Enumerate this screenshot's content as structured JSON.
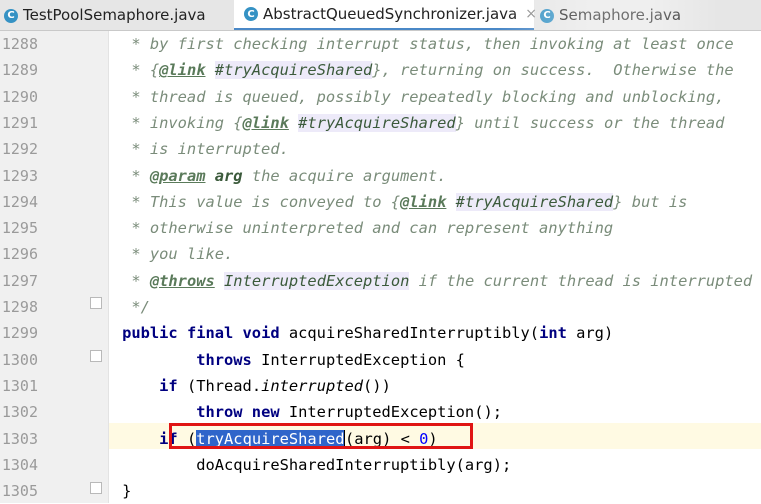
{
  "tabs": [
    {
      "label": "TestPoolSemaphore.java",
      "icon": "c-class-icon",
      "active": false
    },
    {
      "label": "AbstractQueuedSynchronizer.java",
      "icon": "c-class-icon",
      "active": true,
      "close": "×"
    },
    {
      "label": "Semaphore.java",
      "icon": "c-class-icon",
      "active": false
    }
  ],
  "editor": {
    "current_line": "1303",
    "lines": [
      {
        "n": "1288",
        "segments": [
          {
            "t": "     * by first checking interrupt status, then invoking at least once",
            "c": "cm"
          }
        ]
      },
      {
        "n": "1289",
        "segments": [
          {
            "t": "     * {",
            "c": "cm"
          },
          {
            "t": "@link",
            "c": "tag"
          },
          {
            "t": " ",
            "c": "cm"
          },
          {
            "t": "#tryAcquireShared",
            "c": "ref"
          },
          {
            "t": "}, returning on success.  Otherwise the",
            "c": "cm"
          }
        ]
      },
      {
        "n": "1290",
        "segments": [
          {
            "t": "     * thread is queued, possibly repeatedly blocking and unblocking,",
            "c": "cm"
          }
        ]
      },
      {
        "n": "1291",
        "segments": [
          {
            "t": "     * invoking {",
            "c": "cm"
          },
          {
            "t": "@link",
            "c": "tag"
          },
          {
            "t": " ",
            "c": "cm"
          },
          {
            "t": "#tryAcquireShared",
            "c": "ref"
          },
          {
            "t": "} until success or the thread",
            "c": "cm"
          }
        ]
      },
      {
        "n": "1292",
        "segments": [
          {
            "t": "     * is interrupted.",
            "c": "cm"
          }
        ]
      },
      {
        "n": "1293",
        "segments": [
          {
            "t": "     * ",
            "c": "cm"
          },
          {
            "t": "@param",
            "c": "tag"
          },
          {
            "t": " ",
            "c": "cm"
          },
          {
            "t": "arg",
            "c": "pname"
          },
          {
            "t": " the acquire argument.",
            "c": "cm"
          }
        ]
      },
      {
        "n": "1294",
        "segments": [
          {
            "t": "     * This value is conveyed to {",
            "c": "cm"
          },
          {
            "t": "@link",
            "c": "tag"
          },
          {
            "t": " ",
            "c": "cm"
          },
          {
            "t": "#tryAcquireShared",
            "c": "ref"
          },
          {
            "t": "} but is",
            "c": "cm"
          }
        ]
      },
      {
        "n": "1295",
        "segments": [
          {
            "t": "     * otherwise uninterpreted and can represent anything",
            "c": "cm"
          }
        ]
      },
      {
        "n": "1296",
        "segments": [
          {
            "t": "     * you like.",
            "c": "cm"
          }
        ]
      },
      {
        "n": "1297",
        "segments": [
          {
            "t": "     * ",
            "c": "cm"
          },
          {
            "t": "@throws",
            "c": "tag"
          },
          {
            "t": " ",
            "c": "cm"
          },
          {
            "t": "InterruptedException",
            "c": "ref"
          },
          {
            "t": " if the current thread is interrupted",
            "c": "cm"
          }
        ]
      },
      {
        "n": "1298",
        "segments": [
          {
            "t": "     */",
            "c": "cm"
          }
        ]
      },
      {
        "n": "1299",
        "segments": [
          {
            "t": "    ",
            "c": ""
          },
          {
            "t": "public final void",
            "c": "kw"
          },
          {
            "t": " acquireSharedInterruptibly(",
            "c": ""
          },
          {
            "t": "int",
            "c": "kw"
          },
          {
            "t": " arg)",
            "c": ""
          }
        ]
      },
      {
        "n": "1300",
        "segments": [
          {
            "t": "            ",
            "c": ""
          },
          {
            "t": "throws",
            "c": "kw"
          },
          {
            "t": " InterruptedException {",
            "c": ""
          }
        ]
      },
      {
        "n": "1301",
        "segments": [
          {
            "t": "        ",
            "c": ""
          },
          {
            "t": "if",
            "c": "kw"
          },
          {
            "t": " (Thread.",
            "c": ""
          },
          {
            "t": "interrupted",
            "c": "it"
          },
          {
            "t": "())",
            "c": ""
          }
        ]
      },
      {
        "n": "1302",
        "segments": [
          {
            "t": "            ",
            "c": ""
          },
          {
            "t": "throw new",
            "c": "kw"
          },
          {
            "t": " InterruptedException();",
            "c": ""
          }
        ]
      },
      {
        "n": "1303",
        "segments": [
          {
            "t": "        ",
            "c": ""
          },
          {
            "t": "if",
            "c": "kw"
          },
          {
            "t": " (",
            "c": ""
          },
          {
            "t": "tryAcquireShared",
            "c": "sel"
          },
          {
            "t": "",
            "c": "caret"
          },
          {
            "t": "(arg) < ",
            "c": ""
          },
          {
            "t": "0",
            "c": "num"
          },
          {
            "t": ")",
            "c": ""
          }
        ]
      },
      {
        "n": "1304",
        "segments": [
          {
            "t": "            doAcquireSharedInterruptibly(arg);",
            "c": ""
          }
        ]
      },
      {
        "n": "1305",
        "segments": [
          {
            "t": "    }",
            "c": ""
          }
        ]
      }
    ]
  }
}
